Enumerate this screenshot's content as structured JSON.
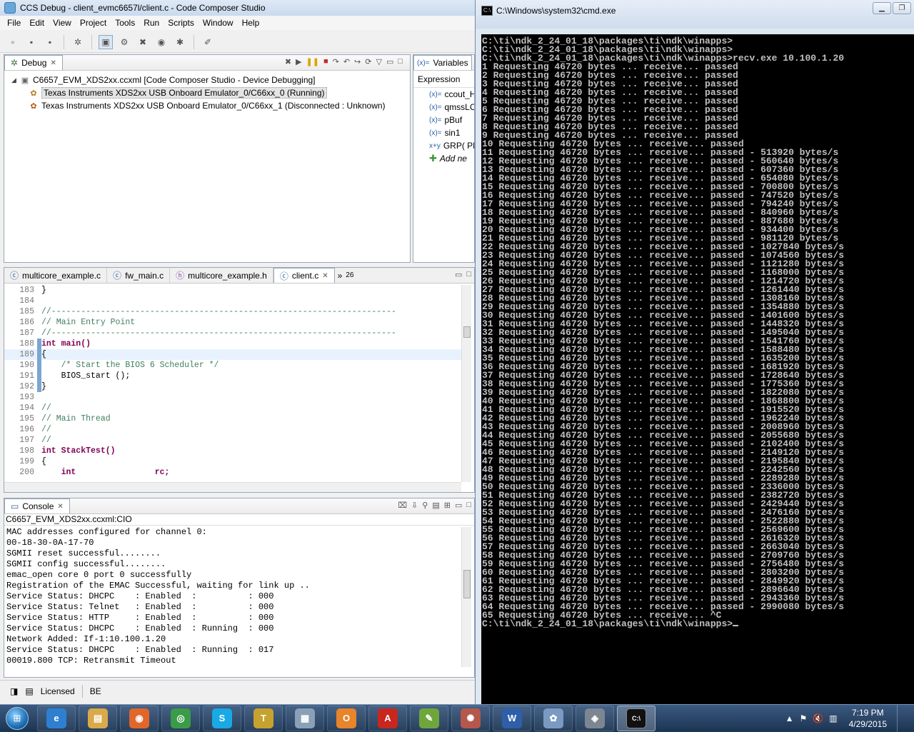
{
  "ccs": {
    "title": "CCS Debug - client_evmc6657l/client.c - Code Composer Studio",
    "menu": [
      "File",
      "Edit",
      "View",
      "Project",
      "Tools",
      "Run",
      "Scripts",
      "Window",
      "Help"
    ],
    "debug_tab": "Debug",
    "debug_tree": {
      "session": "C6657_EVM_XDS2xx.ccxml [Code Composer Studio - Device Debugging]",
      "core0": "Texas Instruments XDS2xx USB Onboard Emulator_0/C66xx_0 (Running)",
      "core1": "Texas Instruments XDS2xx USB Onboard Emulator_0/C66xx_1 (Disconnected : Unknown)"
    },
    "variables_tab": "Variables",
    "variables_header": "Expression",
    "variables": [
      "ccout_H",
      "qmssLC",
      "pBuf",
      "sin1",
      "GRP( PL",
      "Add ne"
    ],
    "editor_tabs": [
      "multicore_example.c",
      "fw_main.c",
      "multicore_example.h",
      "client.c"
    ],
    "editor_overflow": "26",
    "code_lines": [
      {
        "n": "183",
        "t": "}"
      },
      {
        "n": "184",
        "t": ""
      },
      {
        "n": "185",
        "t": "//----------------------------------------------------------------------"
      },
      {
        "n": "186",
        "t": "// Main Entry Point"
      },
      {
        "n": "187",
        "t": "//----------------------------------------------------------------------"
      },
      {
        "n": "188",
        "t": "int main()"
      },
      {
        "n": "189",
        "t": "{"
      },
      {
        "n": "190",
        "t": "    /* Start the BIOS 6 Scheduler */"
      },
      {
        "n": "191",
        "t": "    BIOS_start ();"
      },
      {
        "n": "192",
        "t": "}"
      },
      {
        "n": "193",
        "t": ""
      },
      {
        "n": "194",
        "t": "//"
      },
      {
        "n": "195",
        "t": "// Main Thread"
      },
      {
        "n": "196",
        "t": "//"
      },
      {
        "n": "197",
        "t": "//"
      },
      {
        "n": "198",
        "t": "int StackTest()"
      },
      {
        "n": "199",
        "t": "{"
      },
      {
        "n": "200",
        "t": "    int                rc;"
      }
    ],
    "console_tab": "Console",
    "console_source": "C6657_EVM_XDS2xx.ccxml:CIO",
    "console_lines": [
      "MAC addresses configured for channel 0:",
      "00-18-30-0A-17-70",
      "SGMII reset successful........",
      "SGMII config successful........",
      "emac_open core 0 port 0 successfully",
      "Registration of the EMAC Successful, waiting for link up ..",
      "Service Status: DHCPC    : Enabled  :          : 000",
      "Service Status: Telnet   : Enabled  :          : 000",
      "Service Status: HTTP     : Enabled  :          : 000",
      "Service Status: DHCPC    : Enabled  : Running  : 000",
      "Network Added: If-1:10.100.1.20",
      "Service Status: DHCPC    : Enabled  : Running  : 017",
      "00019.800 TCP: Retransmit Timeout"
    ],
    "status_licensed": "Licensed",
    "status_be": "BE"
  },
  "cmd": {
    "title": "C:\\Windows\\system32\\cmd.exe",
    "lines": [
      "C:\\ti\\ndk_2_24_01_18\\packages\\ti\\ndk\\winapps>",
      "C:\\ti\\ndk_2_24_01_18\\packages\\ti\\ndk\\winapps>",
      "C:\\ti\\ndk_2_24_01_18\\packages\\ti\\ndk\\winapps>recv.exe 10.100.1.20",
      "1 Requesting 46720 bytes ... receive... passed",
      "2 Requesting 46720 bytes ... receive... passed",
      "3 Requesting 46720 bytes ... receive... passed",
      "4 Requesting 46720 bytes ... receive... passed",
      "5 Requesting 46720 bytes ... receive... passed",
      "6 Requesting 46720 bytes ... receive... passed",
      "7 Requesting 46720 bytes ... receive... passed",
      "8 Requesting 46720 bytes ... receive... passed",
      "9 Requesting 46720 bytes ... receive... passed",
      "10 Requesting 46720 bytes ... receive... passed",
      "11 Requesting 46720 bytes ... receive... passed - 513920 bytes/s",
      "12 Requesting 46720 bytes ... receive... passed - 560640 bytes/s",
      "13 Requesting 46720 bytes ... receive... passed - 607360 bytes/s",
      "14 Requesting 46720 bytes ... receive... passed - 654080 bytes/s",
      "15 Requesting 46720 bytes ... receive... passed - 700800 bytes/s",
      "16 Requesting 46720 bytes ... receive... passed - 747520 bytes/s",
      "17 Requesting 46720 bytes ... receive... passed - 794240 bytes/s",
      "18 Requesting 46720 bytes ... receive... passed - 840960 bytes/s",
      "19 Requesting 46720 bytes ... receive... passed - 887680 bytes/s",
      "20 Requesting 46720 bytes ... receive... passed - 934400 bytes/s",
      "21 Requesting 46720 bytes ... receive... passed - 981120 bytes/s",
      "22 Requesting 46720 bytes ... receive... passed - 1027840 bytes/s",
      "23 Requesting 46720 bytes ... receive... passed - 1074560 bytes/s",
      "24 Requesting 46720 bytes ... receive... passed - 1121280 bytes/s",
      "25 Requesting 46720 bytes ... receive... passed - 1168000 bytes/s",
      "26 Requesting 46720 bytes ... receive... passed - 1214720 bytes/s",
      "27 Requesting 46720 bytes ... receive... passed - 1261440 bytes/s",
      "28 Requesting 46720 bytes ... receive... passed - 1308160 bytes/s",
      "29 Requesting 46720 bytes ... receive... passed - 1354880 bytes/s",
      "30 Requesting 46720 bytes ... receive... passed - 1401600 bytes/s",
      "31 Requesting 46720 bytes ... receive... passed - 1448320 bytes/s",
      "32 Requesting 46720 bytes ... receive... passed - 1495040 bytes/s",
      "33 Requesting 46720 bytes ... receive... passed - 1541760 bytes/s",
      "34 Requesting 46720 bytes ... receive... passed - 1588480 bytes/s",
      "35 Requesting 46720 bytes ... receive... passed - 1635200 bytes/s",
      "36 Requesting 46720 bytes ... receive... passed - 1681920 bytes/s",
      "37 Requesting 46720 bytes ... receive... passed - 1728640 bytes/s",
      "38 Requesting 46720 bytes ... receive... passed - 1775360 bytes/s",
      "39 Requesting 46720 bytes ... receive... passed - 1822080 bytes/s",
      "40 Requesting 46720 bytes ... receive... passed - 1868800 bytes/s",
      "41 Requesting 46720 bytes ... receive... passed - 1915520 bytes/s",
      "42 Requesting 46720 bytes ... receive... passed - 1962240 bytes/s",
      "43 Requesting 46720 bytes ... receive... passed - 2008960 bytes/s",
      "44 Requesting 46720 bytes ... receive... passed - 2055680 bytes/s",
      "45 Requesting 46720 bytes ... receive... passed - 2102400 bytes/s",
      "46 Requesting 46720 bytes ... receive... passed - 2149120 bytes/s",
      "47 Requesting 46720 bytes ... receive... passed - 2195840 bytes/s",
      "48 Requesting 46720 bytes ... receive... passed - 2242560 bytes/s",
      "49 Requesting 46720 bytes ... receive... passed - 2289280 bytes/s",
      "50 Requesting 46720 bytes ... receive... passed - 2336000 bytes/s",
      "51 Requesting 46720 bytes ... receive... passed - 2382720 bytes/s",
      "52 Requesting 46720 bytes ... receive... passed - 2429440 bytes/s",
      "53 Requesting 46720 bytes ... receive... passed - 2476160 bytes/s",
      "54 Requesting 46720 bytes ... receive... passed - 2522880 bytes/s",
      "55 Requesting 46720 bytes ... receive... passed - 2569600 bytes/s",
      "56 Requesting 46720 bytes ... receive... passed - 2616320 bytes/s",
      "57 Requesting 46720 bytes ... receive... passed - 2663040 bytes/s",
      "58 Requesting 46720 bytes ... receive... passed - 2709760 bytes/s",
      "59 Requesting 46720 bytes ... receive... passed - 2756480 bytes/s",
      "60 Requesting 46720 bytes ... receive... passed - 2803200 bytes/s",
      "61 Requesting 46720 bytes ... receive... passed - 2849920 bytes/s",
      "62 Requesting 46720 bytes ... receive... passed - 2896640 bytes/s",
      "63 Requesting 46720 bytes ... receive... passed - 2943360 bytes/s",
      "64 Requesting 46720 bytes ... receive... passed - 2990080 bytes/s",
      "65 Requesting 46720 bytes ... receive... ^C",
      "C:\\ti\\ndk_2_24_01_18\\packages\\ti\\ndk\\winapps>"
    ]
  },
  "taskbar": {
    "time": "7:19 PM",
    "date": "4/29/2015",
    "apps": [
      {
        "icon": "internet-explorer-icon",
        "glyph": "e",
        "color": "#2f7fd1"
      },
      {
        "icon": "file-explorer-icon",
        "glyph": "▤",
        "color": "#d9a94a"
      },
      {
        "icon": "firefox-icon",
        "glyph": "◉",
        "color": "#e0662a"
      },
      {
        "icon": "chrome-icon",
        "glyph": "◎",
        "color": "#3a9b48"
      },
      {
        "icon": "skype-icon",
        "glyph": "S",
        "color": "#19a9e5"
      },
      {
        "icon": "ti-ccs-icon",
        "glyph": "T",
        "color": "#c7a22e"
      },
      {
        "icon": "calculator-icon",
        "glyph": "▦",
        "color": "#8aa0b8"
      },
      {
        "icon": "outlook-icon",
        "glyph": "O",
        "color": "#e8842a"
      },
      {
        "icon": "acrobat-icon",
        "glyph": "A",
        "color": "#c8261f"
      },
      {
        "icon": "notepad-plus-icon",
        "glyph": "✎",
        "color": "#6fa63b"
      },
      {
        "icon": "network-icon",
        "glyph": "✺",
        "color": "#b5574b"
      },
      {
        "icon": "word-icon",
        "glyph": "W",
        "color": "#2f5fa8"
      },
      {
        "icon": "paint-icon",
        "glyph": "✿",
        "color": "#7a9ac2"
      },
      {
        "icon": "virtualbox-icon",
        "glyph": "◈",
        "color": "#7d8690"
      },
      {
        "icon": "cmd-icon",
        "glyph": "C:\\",
        "color": "#111111"
      }
    ]
  }
}
